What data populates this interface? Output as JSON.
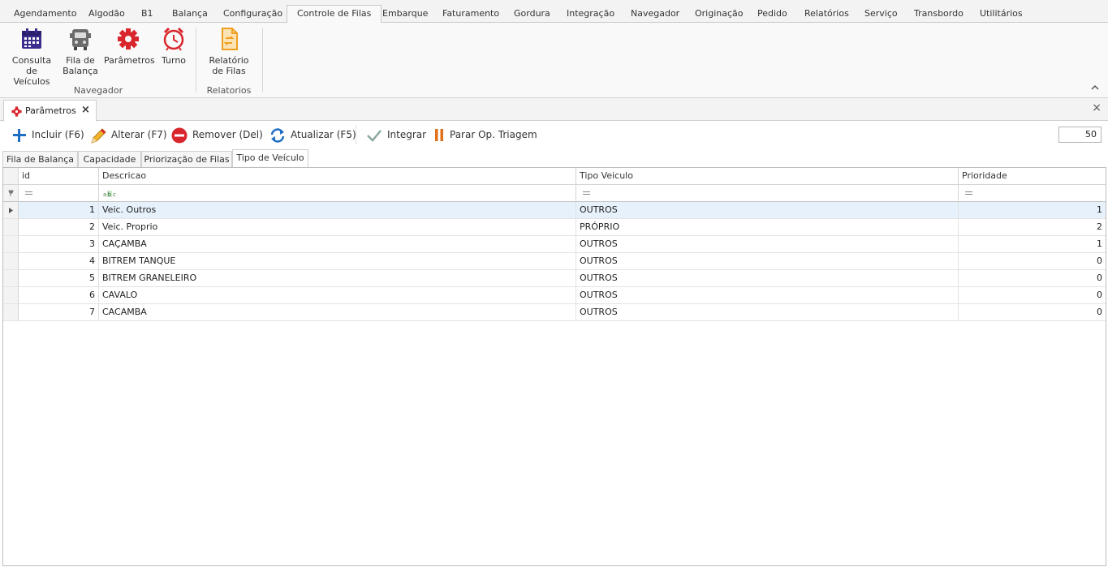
{
  "ribbon": {
    "tabs": [
      "Agendamento",
      "Algodão",
      "B1",
      "Balança",
      "Configuração",
      "Controle de Filas",
      "Embarque",
      "Faturamento",
      "Gordura",
      "Integração",
      "Navegador",
      "Originação",
      "Pedido",
      "Relatórios",
      "Serviço",
      "Transbordo",
      "Utilitários"
    ],
    "active_tab": "Controle de Filas",
    "groups": [
      {
        "label": "Navegador",
        "buttons": [
          {
            "label": "Consulta de\nVeículos",
            "icon": "calendar-icon"
          },
          {
            "label": "Fila de\nBalança",
            "icon": "truck-icon"
          },
          {
            "label": "Parâmetros",
            "icon": "gear-icon"
          },
          {
            "label": "Turno",
            "icon": "alarm-clock-icon"
          }
        ]
      },
      {
        "label": "Relatorios",
        "buttons": [
          {
            "label": "Relatório\nde Filas",
            "icon": "report-refresh-icon"
          }
        ]
      }
    ]
  },
  "document": {
    "tab_label": "Parâmetros",
    "close_glyph": "×"
  },
  "toolbar": {
    "incluir": "Incluir (F6)",
    "alterar": "Alterar (F7)",
    "remover": "Remover (Del)",
    "atualizar": "Atualizar (F5)",
    "integrar": "Integrar",
    "parar": "Parar Op. Triagem",
    "page_size": "50"
  },
  "inner_tabs": [
    "Fila de Balança",
    "Capacidade",
    "Priorização de Filas",
    "Tipo de Veículo"
  ],
  "inner_active": "Tipo de Veículo",
  "grid": {
    "columns": [
      "id",
      "Descricao",
      "Tipo Veiculo",
      "Prioridade"
    ],
    "rows": [
      {
        "id": "1",
        "descricao": "Veic. Outros",
        "tipo": "OUTROS",
        "prioridade": "1"
      },
      {
        "id": "2",
        "descricao": "Veic. Proprio",
        "tipo": "PRÓPRIO",
        "prioridade": "2"
      },
      {
        "id": "3",
        "descricao": "CAÇAMBA",
        "tipo": "OUTROS",
        "prioridade": "1"
      },
      {
        "id": "4",
        "descricao": "BITREM TANQUE",
        "tipo": "OUTROS",
        "prioridade": "0"
      },
      {
        "id": "5",
        "descricao": "BITREM GRANELEIRO",
        "tipo": "OUTROS",
        "prioridade": "0"
      },
      {
        "id": "6",
        "descricao": "CAVALO",
        "tipo": "OUTROS",
        "prioridade": "0"
      },
      {
        "id": "7",
        "descricao": "CACAMBA",
        "tipo": "OUTROS",
        "prioridade": "0"
      }
    ]
  },
  "colors": {
    "accent_blue": "#1e6fc4",
    "danger_red": "#d9262c",
    "selection": "#e6f1fb"
  }
}
